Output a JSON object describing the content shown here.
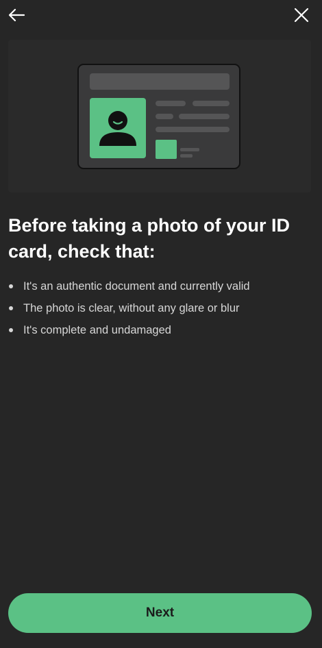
{
  "colors": {
    "background": "#262626",
    "accent": "#5bc185",
    "card_background": "#3a3a3b",
    "bullet_text": "#d7d7d7"
  },
  "toolbar": {
    "back_icon": "arrow-left-icon",
    "close_icon": "close-icon"
  },
  "illustration": {
    "icon": "id-card-icon"
  },
  "heading": "Before taking a photo of your ID card, check that:",
  "checklist": [
    "It's an authentic document and currently valid",
    "The photo is clear, without any glare or blur",
    "It's complete and undamaged"
  ],
  "next_button": {
    "label": "Next"
  }
}
